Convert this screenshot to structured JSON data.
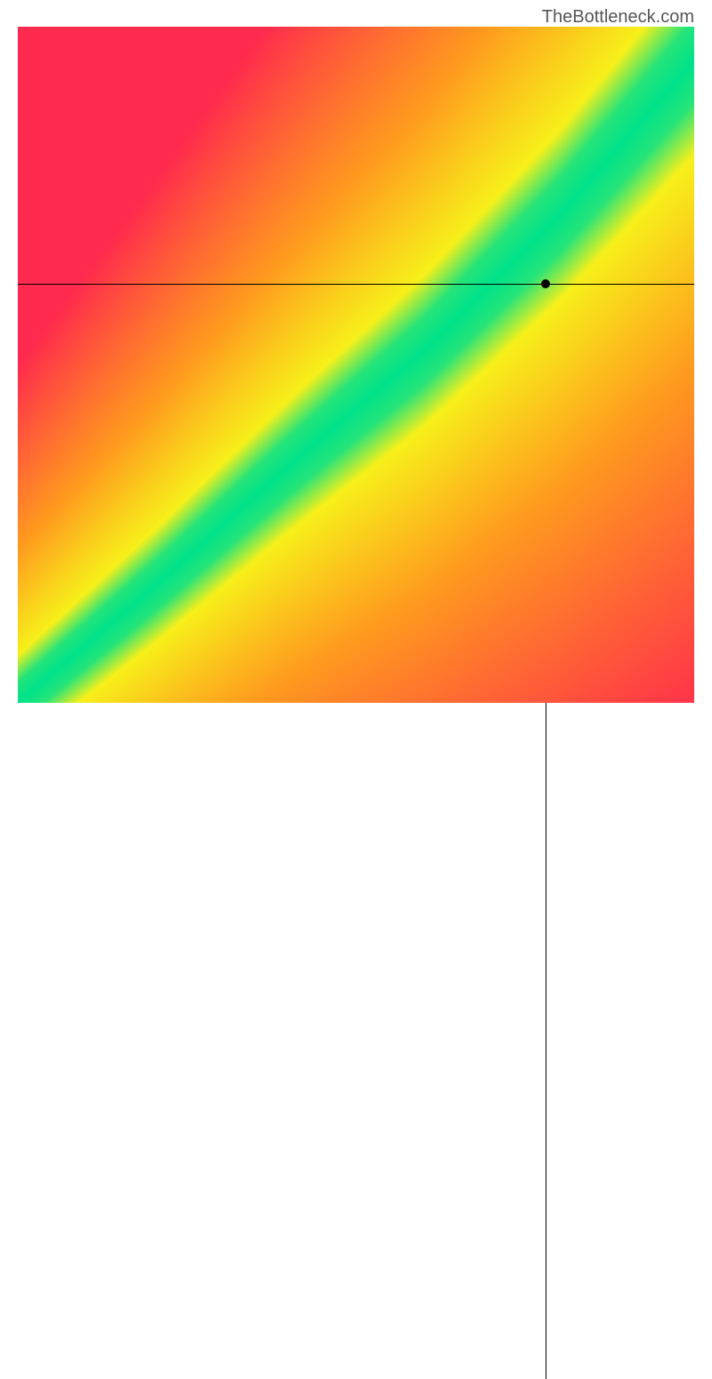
{
  "watermark": "TheBottleneck.com",
  "chart_data": {
    "type": "heatmap",
    "title": "",
    "xlabel": "",
    "ylabel": "",
    "xlim": [
      0,
      100
    ],
    "ylim": [
      0,
      100
    ],
    "crosshair": {
      "x": 78,
      "y": 62
    },
    "marker": {
      "x": 78,
      "y": 62
    },
    "diagonal_band": {
      "description": "Green optimal region along a slightly super-linear diagonal from bottom-left to top-right, surrounded by yellow transition, with red in far off-diagonal corners (top-left and bottom-right).",
      "center_curve_points": [
        {
          "x": 0,
          "y": 0
        },
        {
          "x": 20,
          "y": 17
        },
        {
          "x": 40,
          "y": 35
        },
        {
          "x": 60,
          "y": 52
        },
        {
          "x": 80,
          "y": 72
        },
        {
          "x": 100,
          "y": 95
        }
      ],
      "green_half_width_fraction": 0.06,
      "yellow_half_width_fraction": 0.14
    },
    "color_stops": {
      "optimal": "#00e28a",
      "near": "#f7f01a",
      "mid": "#ff9b1e",
      "far": "#ff2a4d"
    }
  }
}
